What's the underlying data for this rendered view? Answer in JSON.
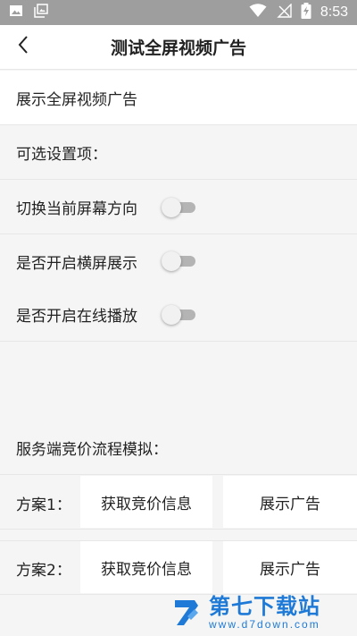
{
  "status_bar": {
    "time": "8:53",
    "left_icons": [
      "image-icon",
      "photo-gallery-icon"
    ],
    "right_icons": [
      "wifi-icon",
      "no-signal-icon",
      "battery-charging-icon"
    ],
    "background": "#9e9e9e"
  },
  "header": {
    "title": "测试全屏视频广告",
    "back_icon": "chevron-left-icon"
  },
  "main": {
    "show_ad_label": "展示全屏视频广告",
    "options_header": "可选设置项：",
    "options": [
      {
        "label": "切换当前屏幕方向",
        "enabled": false
      },
      {
        "label": "是否开启横屏展示",
        "enabled": false
      },
      {
        "label": "是否开启在线播放",
        "enabled": false
      }
    ],
    "bidding_header": "服务端竞价流程模拟：",
    "schemes": [
      {
        "label": "方案1：",
        "fetch_button": "获取竞价信息",
        "show_button": "展示广告"
      },
      {
        "label": "方案2：",
        "fetch_button": "获取竞价信息",
        "show_button": "展示广告"
      }
    ]
  },
  "watermark": {
    "title": "第七下载站",
    "url": "www.d7down.com",
    "color": "#1e7ad6"
  }
}
